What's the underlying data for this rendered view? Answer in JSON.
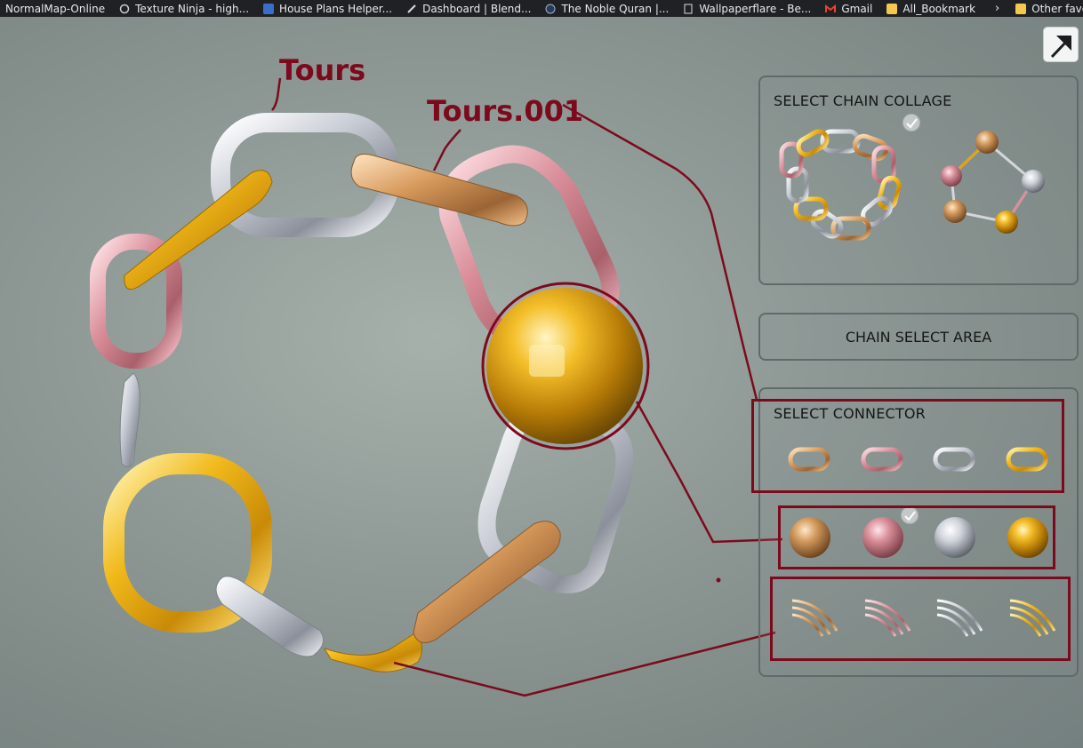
{
  "bookmarks": [
    {
      "label": "NormalMap-Online",
      "icon": "normalmap-icon"
    },
    {
      "label": "Texture Ninja - high...",
      "icon": "texture-ninja-icon"
    },
    {
      "label": "House Plans Helper...",
      "icon": "house-plans-icon"
    },
    {
      "label": "Dashboard | Blend...",
      "icon": "blender-icon"
    },
    {
      "label": "The Noble Quran |...",
      "icon": "quran-icon"
    },
    {
      "label": "Wallpaperflare - Be...",
      "icon": "page-icon"
    },
    {
      "label": "Gmail",
      "icon": "gmail-icon"
    },
    {
      "label": "All_Bookmark",
      "icon": "folder-icon"
    }
  ],
  "bookmarks_overflow": "›",
  "other_favorites": "Other favorites",
  "annotations": {
    "tours": "Tours",
    "tours001": "Tours.001"
  },
  "panel": {
    "collage_title": "SELECT CHAIN COLLAGE",
    "select_area": "CHAIN SELECT AREA",
    "connector_title": "SELECT CONNECTOR"
  },
  "materials": {
    "rose_gold": "#d9a06a",
    "pink": "#d8909c",
    "silver": "#e4e6ec",
    "gold": "#e0a414"
  },
  "annotation_color": "#7c0a1c",
  "icons": {
    "expand": "expand-corner-icon",
    "check": "checkmark-icon"
  }
}
